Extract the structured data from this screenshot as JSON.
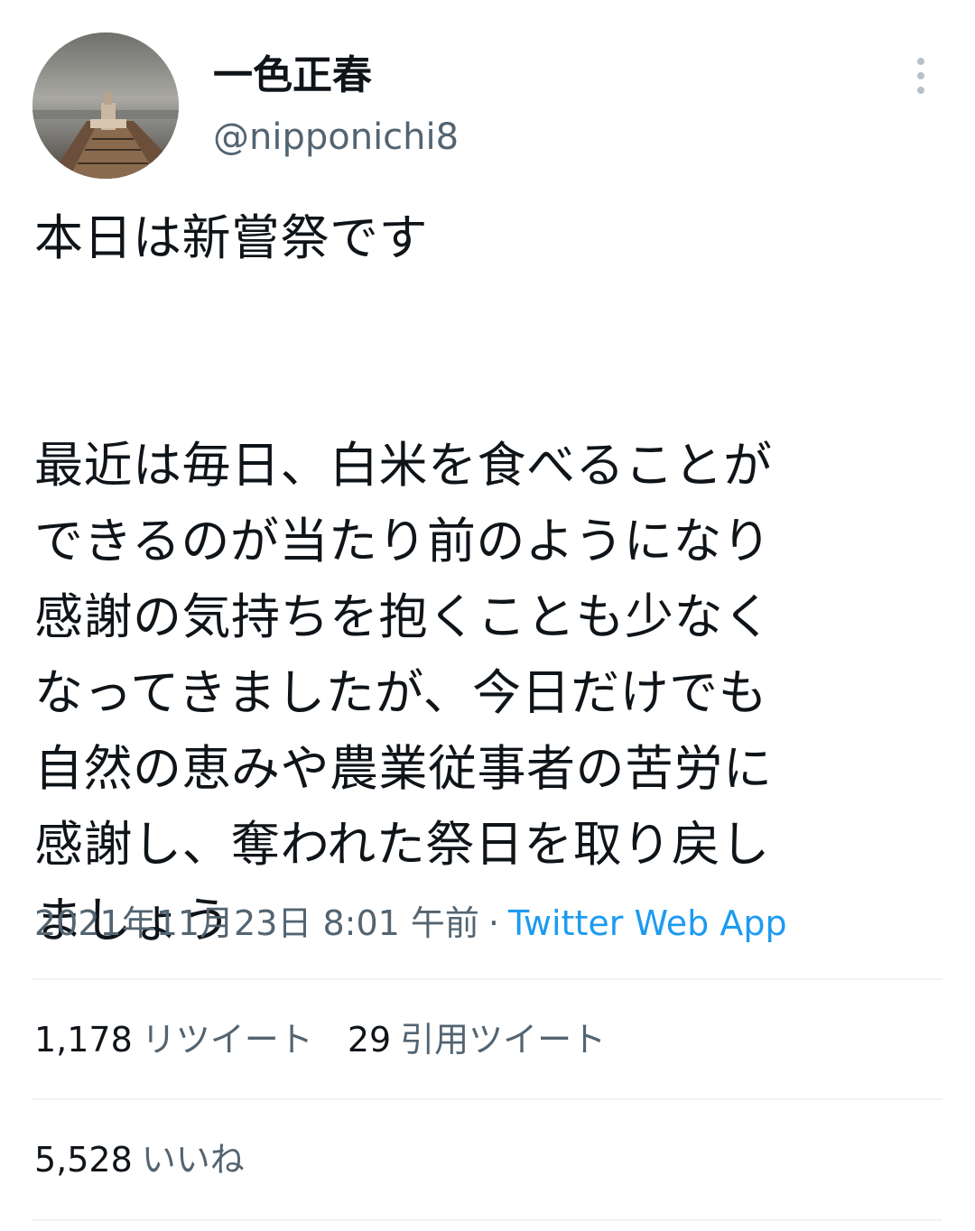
{
  "author": {
    "display_name": "一色正春",
    "handle": "@nipponichi8",
    "avatar_icon": "avatar-tanker-ship-photo"
  },
  "more_icon": "more-vertical-icon",
  "tweet": {
    "lines": [
      "本日は新嘗祭です",
      "最近は毎日、白米を食べることが",
      "できるのが当たり前のようになり",
      "感謝の気持ちを抱くことも少なく",
      "なってきましたが、今日だけでも",
      "自然の恵みや農業従事者の苦労に",
      "感謝し、奪われた祭日を取り戻し",
      "ましょう"
    ]
  },
  "meta": {
    "timestamp": "2021年11月23日 8:01 午前",
    "separator": "·",
    "source": "Twitter Web App"
  },
  "stats": {
    "retweets_count": "1,178",
    "retweets_label": "リツイート",
    "quotes_count": "29",
    "quotes_label": "引用ツイート",
    "likes_count": "5,528",
    "likes_label": "いいね"
  },
  "colors": {
    "text_primary": "#0f1419",
    "text_secondary": "#536471",
    "link": "#1d9bf0",
    "divider": "#eff3f4"
  }
}
